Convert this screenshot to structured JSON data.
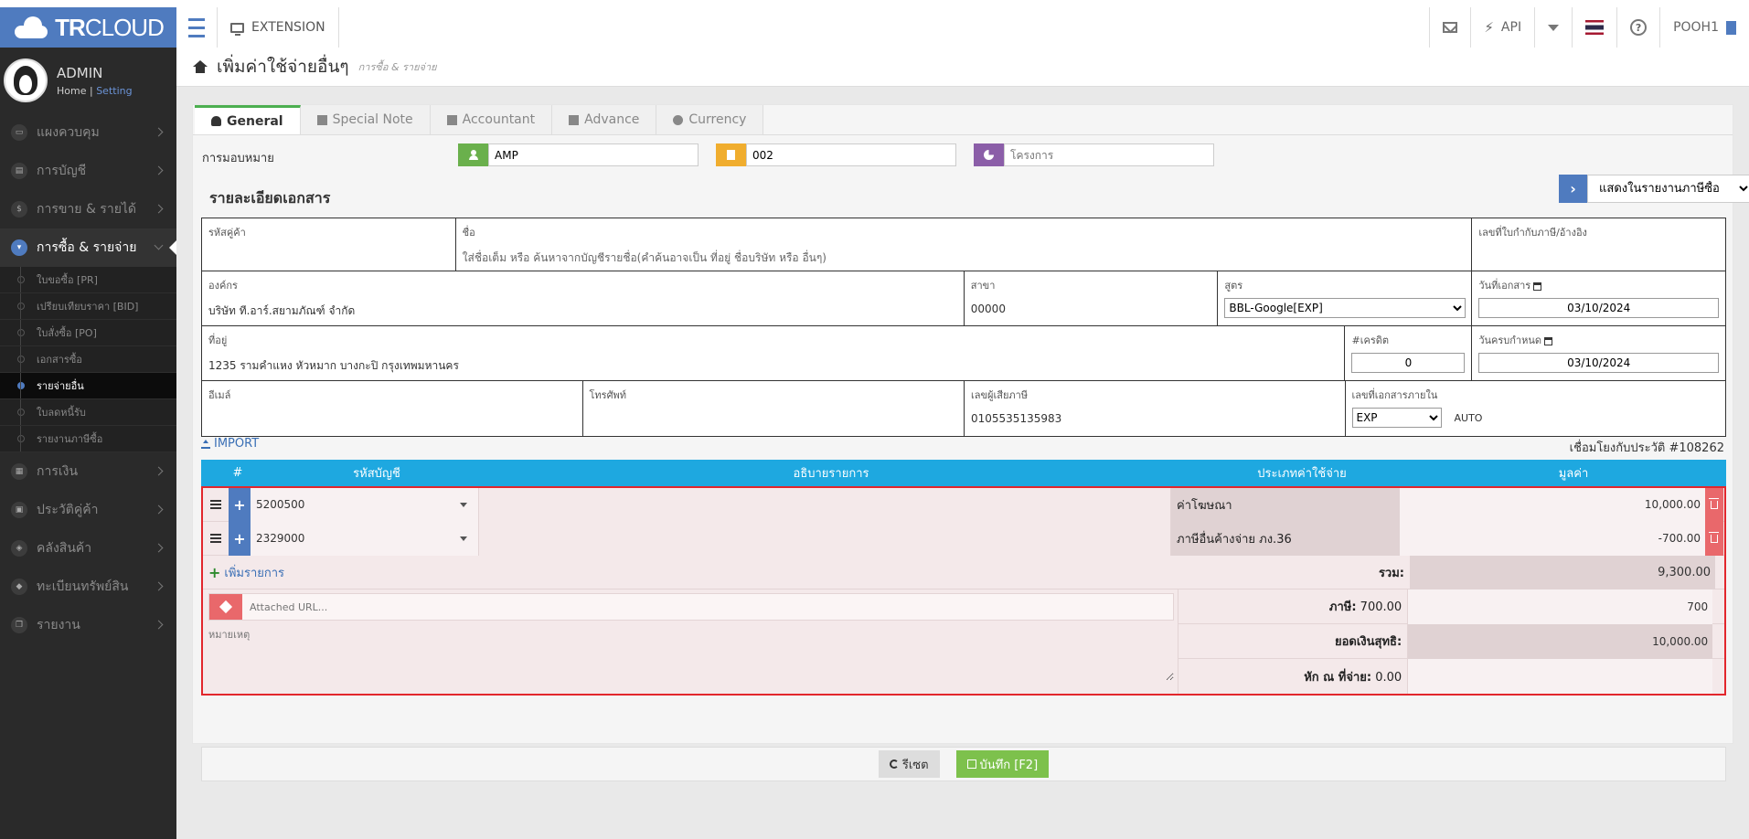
{
  "topbar": {
    "brand_bold": "TR",
    "brand_rest": "CLOUD",
    "extension_label": "EXTENSION",
    "api_label": "API",
    "user_label": "POOH1"
  },
  "profile": {
    "name": "ADMIN",
    "home": "Home",
    "setting": "Setting"
  },
  "sidebar": {
    "items": [
      {
        "label": "แผงควบคุม"
      },
      {
        "label": "การบัญชี"
      },
      {
        "label": "การขาย & รายได้"
      },
      {
        "label": "การซื้อ & รายจ่าย"
      },
      {
        "label": "การเงิน"
      },
      {
        "label": "ประวัติคู่ค้า"
      },
      {
        "label": "คลังสินค้า"
      },
      {
        "label": "ทะเบียนทรัพย์สิน"
      },
      {
        "label": "รายงาน"
      }
    ],
    "sub_items": [
      {
        "label": "ใบขอซื้อ [PR]"
      },
      {
        "label": "เปรียบเทียบราคา [BID]"
      },
      {
        "label": "ใบสั่งซื้อ [PO]"
      },
      {
        "label": "เอกสารซื้อ"
      },
      {
        "label": "รายจ่ายอื่น"
      },
      {
        "label": "ใบลดหนี้รับ"
      },
      {
        "label": "รายงานภาษีซื้อ"
      }
    ]
  },
  "page": {
    "title": "เพิ่มค่าใช้จ่ายอื่นๆ",
    "subtitle": "การซื้อ & รายจ่าย"
  },
  "tabs": [
    {
      "label": "General"
    },
    {
      "label": "Special Note"
    },
    {
      "label": "Accountant"
    },
    {
      "label": "Advance"
    },
    {
      "label": "Currency"
    }
  ],
  "assign": {
    "label": "การมอบหมาย",
    "user_value": "AMP",
    "branch_value": "002",
    "project_placeholder": "โครงการ",
    "colors": {
      "user": "#6ab04c",
      "branch": "#f0ad2e",
      "project": "#8b5ea8"
    }
  },
  "doc": {
    "section_title": "รายละเอียดเอกสาร",
    "show_report": "แสดงในรายงานภาษีซื้อ",
    "vendor_code_label": "รหัสคู่ค้า",
    "name_label": "ชื่อ",
    "name_hint": "ใส่ชื่อเต็ม หรือ ค้นหาจากบัญชีรายชื่อ(คำค้นอาจเป็น ที่อยู่ ชื่อบริษัท หรือ อื่นๆ)",
    "tax_invoice_label": "เลขที่ใบกำกับภาษี/อ้างอิง",
    "org_label": "องค์กร",
    "org_value": "บริษัท ที.อาร์.สยามภัณฑ์ จำกัด",
    "branch_label": "สาขา",
    "branch_value": "00000",
    "formula_label": "สูตร",
    "formula_value": "BBL-Google[EXP]",
    "doc_date_label": "วันที่เอกสาร",
    "doc_date_value": "03/10/2024",
    "address_label": "ที่อยู่",
    "address_value": "1235 รามคำแหง หัวหมาก บางกะปิ กรุงเทพมหานคร",
    "credit_label": "#เครดิต",
    "credit_value": "0",
    "due_date_label": "วันครบกำหนด",
    "due_date_value": "03/10/2024",
    "email_label": "อีเมล์",
    "phone_label": "โทรศัพท์",
    "taxid_label": "เลขผู้เสียภาษี",
    "taxid_value": "0105535135983",
    "internal_no_label": "เลขที่เอกสารภายใน",
    "internal_no_value": "EXP",
    "auto_label": "AUTO"
  },
  "import_label": "IMPORT",
  "link_ref": "เชื่อมโยงกับประวัติ #108262",
  "lines": {
    "headers": {
      "num": "#",
      "account": "รหัสบัญชี",
      "description": "อธิบายรายการ",
      "type": "ประเภทค่าใช้จ่าย",
      "amount": "มูลค่า"
    },
    "rows": [
      {
        "account": "5200500",
        "type": "ค่าโฆษณา",
        "amount": "10,000.00"
      },
      {
        "account": "2329000",
        "type": "ภาษีอื่นค้างจ่าย ภง.36",
        "amount": "-700.00"
      }
    ],
    "add_label": "เพิ่มรายการ",
    "total_label": "รวม:",
    "total_value": "9,300.00",
    "url_placeholder": "Attached URL...",
    "remark_placeholder": "หมายเหตุ",
    "tax_label": "ภาษี:",
    "tax_amount": "700.00",
    "tax_value": "700",
    "net_label": "ยอดเงินสุทธิ:",
    "net_value": "10,000.00",
    "wht_label": "หัก ณ ที่จ่าย:",
    "wht_amount": "0.00"
  },
  "actions": {
    "reset": "รีเซต",
    "save": "บันทึก [F2]"
  }
}
